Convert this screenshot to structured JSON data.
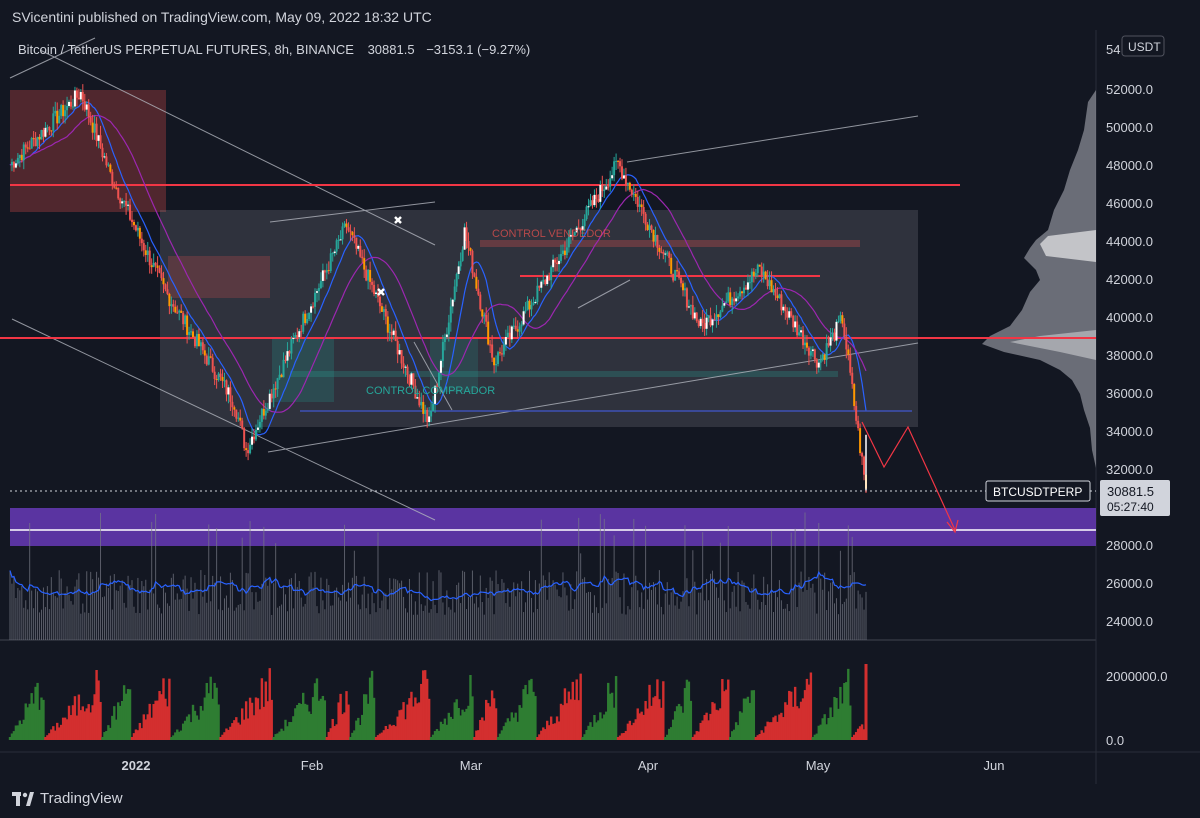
{
  "header": {
    "published": "SVicentini published on TradingView.com, May 09, 2022 18:32 UTC"
  },
  "legend": {
    "symbol": "Bitcoin / TetherUS PERPETUAL FUTURES, 8h, BINANCE",
    "last": "30881.5",
    "change": "−3153.1 (−9.27%)"
  },
  "price_axis": {
    "currency": "USDT",
    "top_partial": "54",
    "ticks": [
      "52000.0",
      "50000.0",
      "48000.0",
      "46000.0",
      "44000.0",
      "42000.0",
      "40000.0",
      "38000.0",
      "36000.0",
      "34000.0",
      "32000.0",
      "28000.0",
      "26000.0",
      "24000.0"
    ]
  },
  "osc_axis": {
    "ticks": [
      "2000000.0",
      "0.0"
    ]
  },
  "time_axis": {
    "ticks": [
      "2022",
      "Feb",
      "Mar",
      "Apr",
      "May",
      "Jun"
    ]
  },
  "annotations": {
    "control_vendedor": "CONTROL VENDEDOR",
    "control_comprador": "CONTROL COMPRADOR"
  },
  "symbol_tag": {
    "label": "BTCUSDTPERP",
    "price": "30881.5",
    "countdown": "05:27:40"
  },
  "footer": {
    "brand": "TradingView"
  },
  "colors": {
    "bg": "#131722",
    "up": "#26a69a",
    "down": "#ef5350",
    "resistance": "#f23645",
    "zone": "#673ab7",
    "ma_blue": "#2962ff",
    "ma_purple": "#9c27b0"
  },
  "chart_data": {
    "type": "candlestick",
    "timeframe": "8h",
    "ylim": [
      23000,
      54500
    ],
    "price_series_key_points": [
      {
        "date": "2021-12-15",
        "price": 48000
      },
      {
        "date": "2021-12-27",
        "price": 51800
      },
      {
        "date": "2022-01-01",
        "price": 47500
      },
      {
        "date": "2022-01-10",
        "price": 41500
      },
      {
        "date": "2022-01-22",
        "price": 35500
      },
      {
        "date": "2022-01-24",
        "price": 33000
      },
      {
        "date": "2022-02-01",
        "price": 38700
      },
      {
        "date": "2022-02-10",
        "price": 44800
      },
      {
        "date": "2022-02-14",
        "price": 41800
      },
      {
        "date": "2022-02-24",
        "price": 34400
      },
      {
        "date": "2022-03-02",
        "price": 44500
      },
      {
        "date": "2022-03-07",
        "price": 37600
      },
      {
        "date": "2022-03-28",
        "price": 48100
      },
      {
        "date": "2022-04-11",
        "price": 39500
      },
      {
        "date": "2022-04-21",
        "price": 42500
      },
      {
        "date": "2022-05-01",
        "price": 37600
      },
      {
        "date": "2022-05-05",
        "price": 39900
      },
      {
        "date": "2022-05-09",
        "price": 30881.5
      }
    ],
    "levels": [
      47000,
      39000
    ],
    "support_zone": [
      28000,
      30000
    ],
    "volume_profile_poc": 44000
  }
}
